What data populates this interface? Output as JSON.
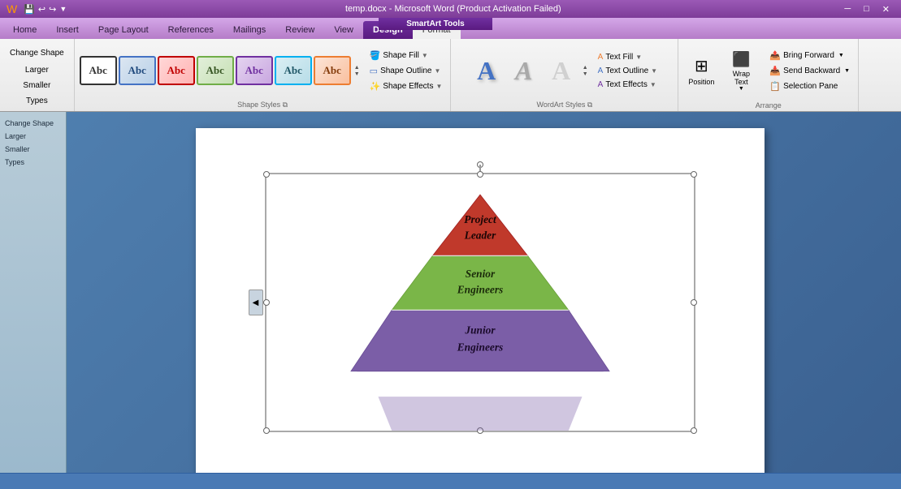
{
  "titlebar": {
    "app_label": "SmartArt Tools",
    "title": "temp.docx - Microsoft Word (Product Activation Failed)",
    "quick_icons": [
      "word-icon",
      "save-icon",
      "undo-icon",
      "redo-icon",
      "customize-icon"
    ]
  },
  "ribbon_tabs": {
    "smartart_tools": "SmartArt Tools",
    "tabs": [
      {
        "label": "Home",
        "active": false
      },
      {
        "label": "Insert",
        "active": false
      },
      {
        "label": "Page Layout",
        "active": false
      },
      {
        "label": "References",
        "active": false
      },
      {
        "label": "Mailings",
        "active": false
      },
      {
        "label": "Review",
        "active": false
      },
      {
        "label": "View",
        "active": false
      },
      {
        "label": "Design",
        "active": false
      },
      {
        "label": "Format",
        "active": true
      }
    ]
  },
  "ribbon": {
    "shape_styles_section": {
      "label": "Shape Styles",
      "buttons": [
        {
          "style": "white",
          "label": "Abc",
          "selected": true
        },
        {
          "style": "blue",
          "label": "Abc"
        },
        {
          "style": "red",
          "label": "Abc"
        },
        {
          "style": "green",
          "label": "Abc"
        },
        {
          "style": "purple",
          "label": "Abc"
        },
        {
          "style": "teal",
          "label": "Abc"
        },
        {
          "style": "orange",
          "label": "Abc"
        }
      ],
      "dropdowns": [
        {
          "label": "Shape Fill",
          "icon": "fill-icon"
        },
        {
          "label": "Shape Outline",
          "icon": "outline-icon"
        },
        {
          "label": "Shape Effects",
          "icon": "effects-icon"
        }
      ]
    },
    "wordart_styles_section": {
      "label": "WordArt Styles",
      "letters": [
        "A",
        "A",
        "A"
      ],
      "dropdowns": [
        {
          "label": "Text Fill",
          "icon": "textfill-icon"
        },
        {
          "label": "Text Outline",
          "icon": "textoutline-icon"
        },
        {
          "label": "Text Effects",
          "icon": "texteffects-icon"
        }
      ]
    },
    "arrange_section": {
      "label": "Arrange",
      "position_label": "Position",
      "wrap_text_label": "Wrap\nText",
      "buttons": [
        {
          "label": "Bring Forward",
          "icon": "bring-forward-icon"
        },
        {
          "label": "Send Backward",
          "icon": "send-backward-icon"
        },
        {
          "label": "Selection Pane",
          "icon": "selection-pane-icon"
        }
      ]
    }
  },
  "sidebar": {
    "items": [
      {
        "label": "Change Shape"
      },
      {
        "label": "Larger"
      },
      {
        "label": "Smaller"
      },
      {
        "label": "Types"
      }
    ]
  },
  "pyramid": {
    "levels": [
      {
        "text": "Project\nLeader",
        "color": "#c0392b",
        "fill": "#c0392b"
      },
      {
        "text": "Senior\nEngineers",
        "color": "#7ab648",
        "fill": "#7ab648"
      },
      {
        "text": "Junior\nEngineers",
        "color": "#7b5ea7",
        "fill": "#7b5ea7"
      }
    ]
  },
  "status_bar": {
    "text": ""
  }
}
